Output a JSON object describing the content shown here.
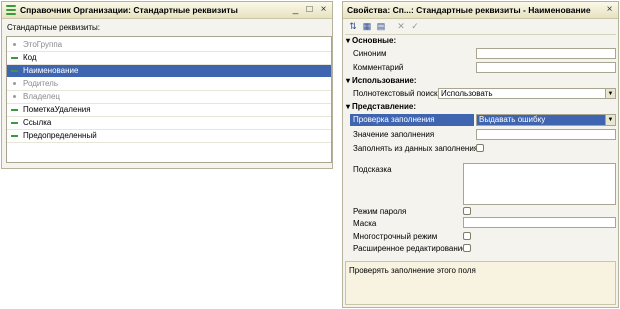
{
  "left_window": {
    "title": "Справочник Организации: Стандартные реквизиты",
    "section_label": "Стандартные реквизиты:",
    "items": [
      {
        "label": "ЭтоГруппа",
        "icon": "gray-dot",
        "dim": true,
        "selected": false
      },
      {
        "label": "Код",
        "icon": "green-dash",
        "dim": false,
        "selected": false
      },
      {
        "label": "Наименование",
        "icon": "green-dash",
        "dim": false,
        "selected": true
      },
      {
        "label": "Родитель",
        "icon": "gray-dot",
        "dim": true,
        "selected": false
      },
      {
        "label": "Владелец",
        "icon": "gray-dot",
        "dim": true,
        "selected": false
      },
      {
        "label": "ПометкаУдаления",
        "icon": "green-dash",
        "dim": false,
        "selected": false
      },
      {
        "label": "Ссылка",
        "icon": "green-dash",
        "dim": false,
        "selected": false
      },
      {
        "label": "Предопределенный",
        "icon": "green-dash",
        "dim": false,
        "selected": false
      }
    ],
    "buttons": {
      "minimize": "_",
      "maximize": "□",
      "close": "×"
    }
  },
  "right_window": {
    "title": "Свойства: Сп...: Стандартные реквизиты - Наименование",
    "buttons": {
      "close": "×"
    },
    "sections": {
      "main": "Основные:",
      "usage": "Использование:",
      "presentation": "Представление:"
    },
    "fields": {
      "synonym_label": "Синоним",
      "synonym_value": "",
      "comment_label": "Комментарий",
      "comment_value": "",
      "fulltext_label": "Полнотекстовый поиск",
      "fulltext_value": "Использовать",
      "fill_check_label": "Проверка заполнения",
      "fill_check_value": "Выдавать ошибку",
      "fill_value_label": "Значение заполнения",
      "fill_from_label": "Заполнять из данных заполнения",
      "hint_label": "Подсказка",
      "password_label": "Режим пароля",
      "mask_label": "Маска",
      "multiline_label": "Многострочный режим",
      "ext_edit_label": "Расширенное редактирование"
    },
    "description": "Проверять заполнение этого поля"
  },
  "colors": {
    "selection": "#3f65b1",
    "accent_green": "#3b9a3b",
    "panel": "#f4f3ee"
  }
}
